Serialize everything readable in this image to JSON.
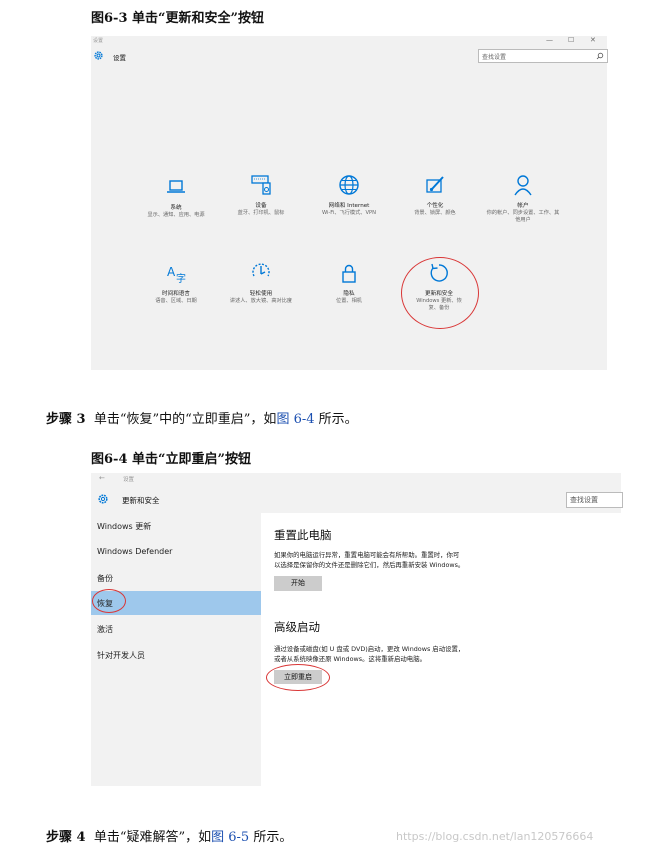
{
  "caption1": "图6-3  单击“更新和安全”按钮",
  "settings_window": {
    "caption_small": "设置",
    "controls": [
      "—",
      "☐",
      "✕"
    ],
    "title": "设置",
    "search_placeholder": "查找设置",
    "tiles": [
      {
        "icon": "laptop-icon",
        "title": "系统",
        "desc": "显示、通知、应用、电源"
      },
      {
        "icon": "keyboard-speaker-icon",
        "title": "设备",
        "desc": "蓝牙、打印机、鼠标"
      },
      {
        "icon": "globe-icon",
        "title": "网络和 Internet",
        "desc": "Wi-Fi、飞行模式、VPN"
      },
      {
        "icon": "paint-icon",
        "title": "个性化",
        "desc": "背景、锁屏、颜色"
      },
      {
        "icon": "person-icon",
        "title": "帐户",
        "desc": "你的帐户、同步设置、工作、其他用户"
      },
      {
        "icon": "language-icon",
        "title": "时间和语言",
        "desc": "语音、区域、日期"
      },
      {
        "icon": "ease-of-access-icon",
        "title": "轻松使用",
        "desc": "讲述人、放大镜、高对比度"
      },
      {
        "icon": "lock-icon",
        "title": "隐私",
        "desc": "位置、相机"
      },
      {
        "icon": "update-icon",
        "title": "更新和安全",
        "desc": "Windows 更新、恢复、备份"
      }
    ]
  },
  "step3": {
    "label": "步骤 3",
    "text_pre": "单击“恢复”中的“立即重启”，如",
    "ref": "图 6-4",
    "text_post": "所示。"
  },
  "caption2": "图6-4  单击“立即重启”按钮",
  "update_window": {
    "back_arrow": "←",
    "caption_small": "设置",
    "title": "更新和安全",
    "search_placeholder": "查找设置",
    "sidebar": [
      "Windows 更新",
      "Windows Defender",
      "备份",
      "恢复",
      "激活",
      "针对开发人员"
    ],
    "selected_index": 3,
    "reset": {
      "heading": "重置此电脑",
      "line1": "如果你的电脑运行异常，重置电脑可能会有所帮助。重置时，你可",
      "line2": "以选择是保留你的文件还是删除它们，然后再重新安装 Windows。",
      "button": "开始"
    },
    "advanced": {
      "heading": "高级启动",
      "line1": "通过设备或磁盘(如 U 盘或 DVD)启动，更改 Windows 启动设置，",
      "line2": "或者从系统映像还原 Windows。这将重新启动电脑。",
      "button": "立即重启"
    }
  },
  "step4": {
    "label": "步骤 4",
    "text_pre": "单击“疑难解答”，如",
    "ref": "图 6-5",
    "text_post": "所示。"
  },
  "watermark": "https://blog.csdn.net/lan120576664",
  "colors": {
    "accent": "#0078d7",
    "selected": "#9ec8ec",
    "highlight_ring": "#d93636"
  }
}
